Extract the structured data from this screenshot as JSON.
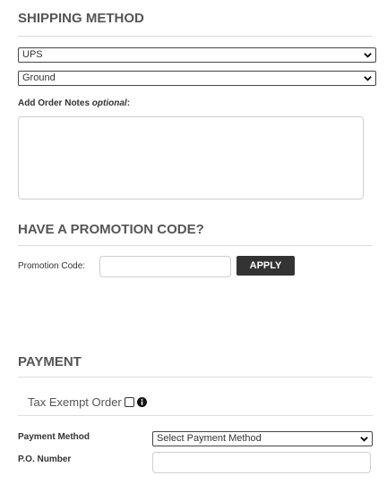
{
  "shipping": {
    "heading": "SHIPPING METHOD",
    "carrier": "UPS",
    "service": "Ground",
    "notes_label": "Add Order Notes",
    "notes_optional": "optional",
    "notes_colon": ":"
  },
  "promo": {
    "heading": "HAVE A PROMOTION CODE?",
    "label": "Promotion Code:",
    "apply": "APPLY"
  },
  "payment": {
    "heading": "PAYMENT",
    "tax_exempt": "Tax Exempt Order",
    "method_label": "Payment Method",
    "method_value": "Select Payment Method",
    "po_label": "P.O. Number"
  }
}
